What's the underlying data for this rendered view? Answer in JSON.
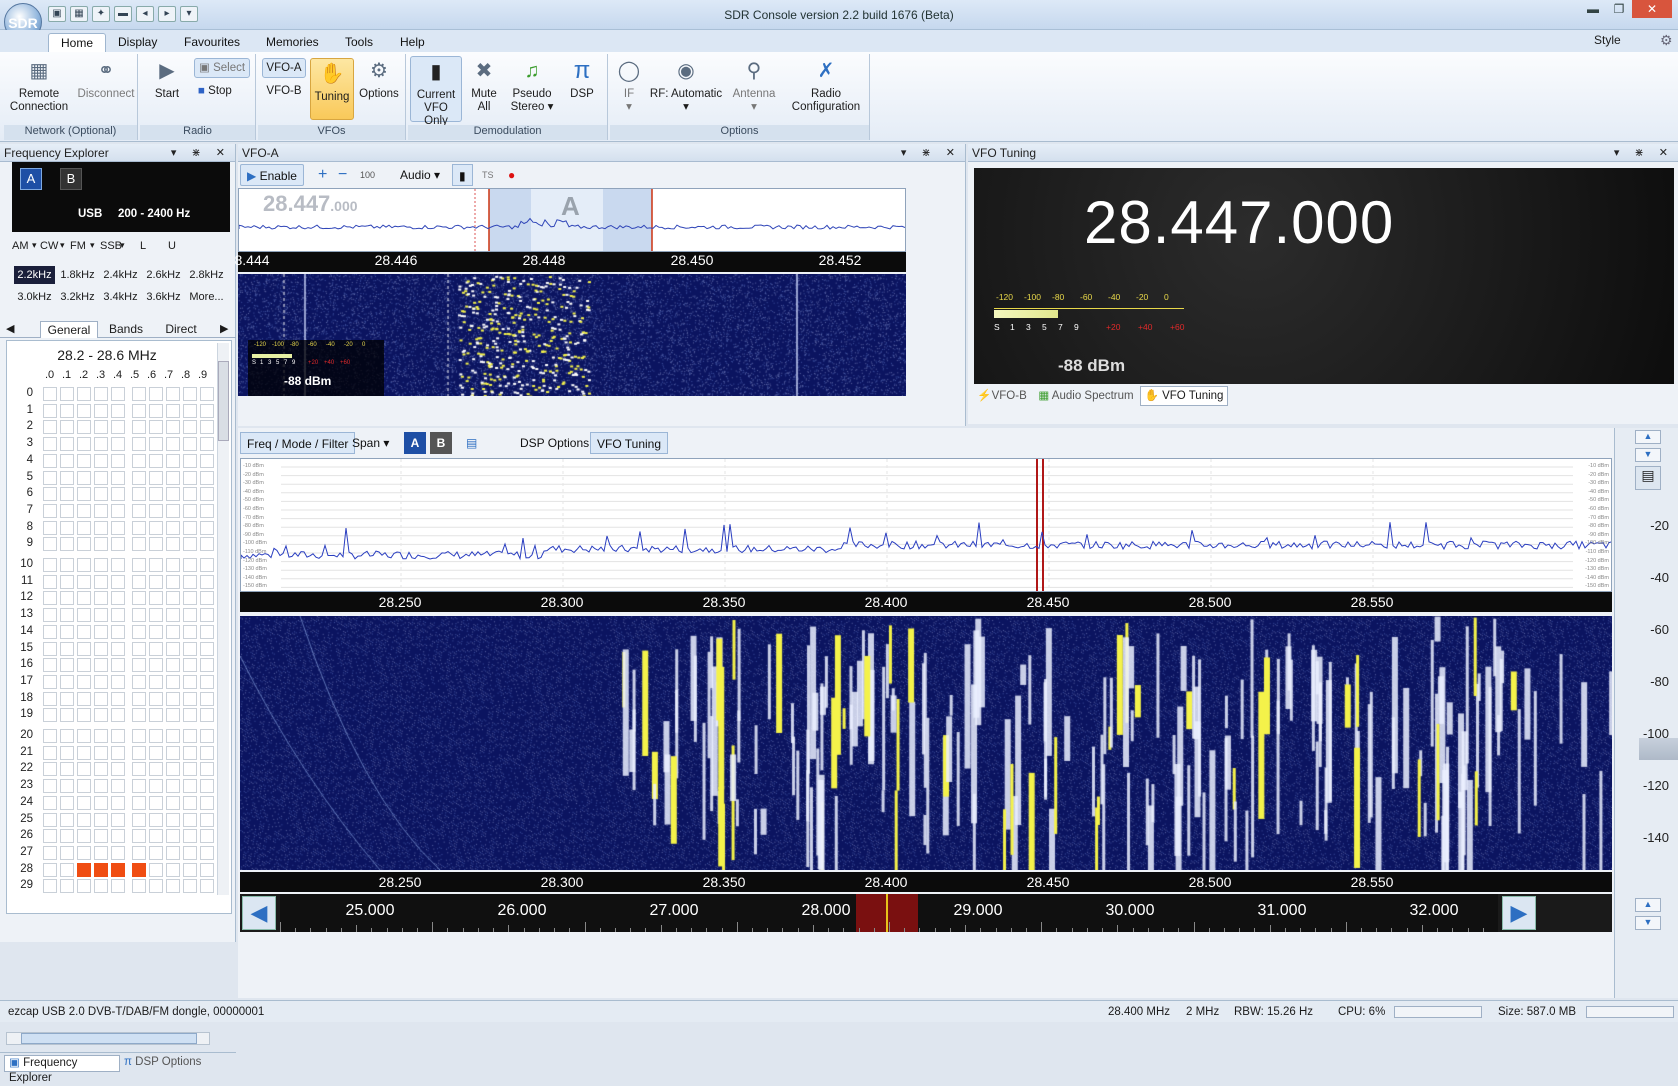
{
  "window": {
    "title": "SDR Console version 2.2 build 1676 (Beta)"
  },
  "quick_access": [
    "camera",
    "grid",
    "wand",
    "folder",
    "nav-back",
    "nav-fwd",
    "dropdown"
  ],
  "ribbon_tabs": [
    "Home",
    "Display",
    "Favourites",
    "Memories",
    "Tools",
    "Help"
  ],
  "style_label": "Style",
  "ribbon": {
    "network": {
      "label": "Network (Optional)",
      "remote": "Remote",
      "connection": "Connection",
      "disconnect": "Disconnect"
    },
    "radio": {
      "label": "Radio",
      "start": "Start",
      "select": "Select",
      "stop": "Stop"
    },
    "vfos": {
      "label": "VFOs",
      "vfo_a": "VFO-A",
      "vfo_b": "VFO-B",
      "tuning": "Tuning",
      "options": "Options"
    },
    "demodulation": {
      "label": "Demodulation",
      "current": "Current",
      "vfo_only": "VFO Only",
      "mute": "Mute",
      "all": "All",
      "pseudo": "Pseudo",
      "stereo": "Stereo",
      "dsp": "DSP"
    },
    "options": {
      "label": "Options",
      "if": "IF",
      "rf": "RF: Automatic",
      "antenna": "Antenna",
      "radio": "Radio",
      "configuration": "Configuration"
    }
  },
  "freq_explorer": {
    "title": "Frequency Explorer",
    "vfo_a": "A",
    "vfo_b": "B",
    "mode": "USB",
    "filter": "200 - 2400 Hz",
    "modes": [
      "AM",
      "CW",
      "FM",
      "SSB",
      "L",
      "U"
    ],
    "bandwidths": [
      "2.2kHz",
      "1.8kHz",
      "2.4kHz",
      "2.6kHz",
      "2.8kHz",
      "3.0kHz",
      "3.2kHz",
      "3.4kHz",
      "3.6kHz",
      "More..."
    ],
    "tabs": [
      "General",
      "Bands",
      "Direct"
    ],
    "range": "28.2 - 28.6 MHz",
    "cols": [
      ".0",
      ".1",
      ".2",
      ".3",
      ".4",
      ".5",
      ".6",
      ".7",
      ".8",
      ".9"
    ],
    "rows": [
      "0",
      "1",
      "2",
      "3",
      "4",
      "5",
      "6",
      "7",
      "8",
      "9",
      "10",
      "11",
      "12",
      "13",
      "14",
      "15",
      "16",
      "17",
      "18",
      "19",
      "20",
      "21",
      "22",
      "23",
      "24",
      "25",
      "26",
      "27",
      "28",
      "29"
    ],
    "highlight": {
      "row": "28",
      "cols": [
        ".2",
        ".3",
        ".4",
        ".5"
      ]
    },
    "bottom_tabs": [
      "Frequency Explorer",
      "DSP Options"
    ]
  },
  "vfo_a": {
    "title": "VFO-A",
    "enable": "Enable",
    "audio": "Audio",
    "vol_label": "100",
    "freq_big": "28.447",
    "freq_small": ".000",
    "marker": "A",
    "scale": [
      "8.444",
      "28.446",
      "28.448",
      "28.450",
      "28.452"
    ],
    "meter_ticks": [
      "-120",
      "-100",
      "-80",
      "-60",
      "-40",
      "-20",
      "0"
    ],
    "s_ticks": [
      "S",
      "1",
      "3",
      "5",
      "7",
      "9"
    ],
    "db_ticks": [
      "+20",
      "+40",
      "+60"
    ],
    "level": "-88 dBm"
  },
  "vfo_tuning": {
    "title": "VFO Tuning",
    "frequency": "28.447.000",
    "meter_ticks": [
      "-120",
      "-100",
      "-80",
      "-60",
      "-40",
      "-20",
      "0"
    ],
    "s_ticks": [
      "S",
      "1",
      "3",
      "5",
      "7",
      "9"
    ],
    "db_ticks": [
      "+20",
      "+40",
      "+60"
    ],
    "level": "-88 dBm",
    "tabs": [
      "VFO-B",
      "Audio Spectrum",
      "VFO Tuning"
    ]
  },
  "main": {
    "toolbar": {
      "freq_mode": "Freq / Mode / Filter",
      "span": "Span",
      "a": "A",
      "b": "B",
      "dsp": "DSP Options",
      "vfo_tuning": "VFO Tuning"
    },
    "db_left": [
      "-10 dBm",
      "-20 dBm",
      "-30 dBm",
      "-40 dBm",
      "-50 dBm",
      "-60 dBm",
      "-70 dBm",
      "-80 dBm",
      "-90 dBm",
      "-100 dBm",
      "-110 dBm",
      "-120 dBm",
      "-130 dBm",
      "-140 dBm",
      "-150 dBm"
    ],
    "db_right": [
      "-10 dBm",
      "-20 dBm",
      "-30 dBm",
      "-40 dBm",
      "-50 dBm",
      "-60 dBm",
      "-70 dBm",
      "-80 dBm",
      "-90 dBm",
      "-100 dBm",
      "-110 dBm",
      "-120 dBm",
      "-130 dBm",
      "-140 dBm",
      "-150 dBm"
    ],
    "scale": [
      "28.250",
      "28.300",
      "28.350",
      "28.400",
      "28.450",
      "28.500",
      "28.550"
    ],
    "side_scale": [
      "-20",
      "-40",
      "-60",
      "-80",
      "-100",
      "-120",
      "-140"
    ],
    "band_scale": [
      "25.000",
      "26.000",
      "27.000",
      "28.000",
      "29.000",
      "30.000",
      "31.000",
      "32.000"
    ]
  },
  "status": {
    "device": "ezcap USB 2.0 DVB-T/DAB/FM dongle, 00000001",
    "freq": "28.400 MHz",
    "span": "2 MHz",
    "rbw": "RBW: 15.26 Hz",
    "cpu": "CPU: 6%",
    "size": "Size: 587.0 MB"
  }
}
